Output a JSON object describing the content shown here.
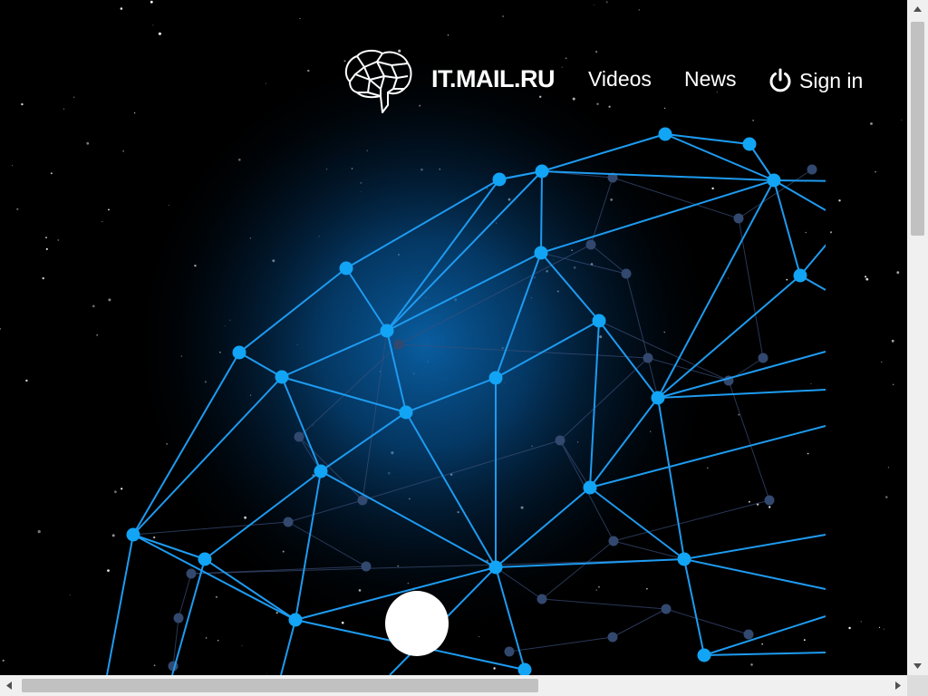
{
  "nav": {
    "brand": "IT.MAIL.RU",
    "videos": "Videos",
    "news": "News",
    "signin": "Sign in"
  },
  "icons": {
    "logo": "brain-icon",
    "signin": "power-icon",
    "scroll": "circle-icon"
  },
  "colors": {
    "accent": "#1e9bf0",
    "node": "#12a4f5",
    "background": "#000000",
    "text": "#ffffff"
  }
}
